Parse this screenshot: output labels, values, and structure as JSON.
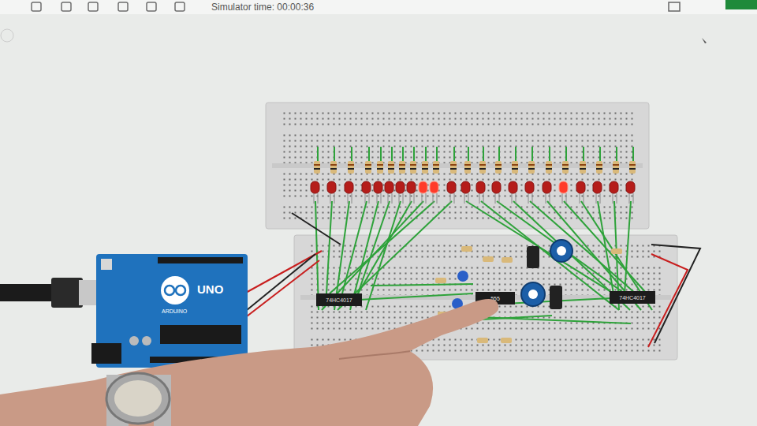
{
  "toolbar": {
    "simulator_time": "Simulator time: 00:00:36"
  },
  "arduino": {
    "brand": "ARDUINO",
    "model": "UNO"
  },
  "chips": [
    {
      "label": "74HC4017"
    },
    {
      "label": "555"
    },
    {
      "label": "74HC4017"
    }
  ],
  "leds": [
    {
      "on": false
    },
    {
      "on": false
    },
    {
      "on": false
    },
    {
      "on": false
    },
    {
      "on": false
    },
    {
      "on": false
    },
    {
      "on": false
    },
    {
      "on": false
    },
    {
      "on": true
    },
    {
      "on": true
    },
    {
      "on": false
    },
    {
      "on": false
    },
    {
      "on": false
    },
    {
      "on": false
    },
    {
      "on": false
    },
    {
      "on": false
    },
    {
      "on": false
    },
    {
      "on": true
    },
    {
      "on": false
    },
    {
      "on": false
    },
    {
      "on": false
    },
    {
      "on": false
    }
  ]
}
